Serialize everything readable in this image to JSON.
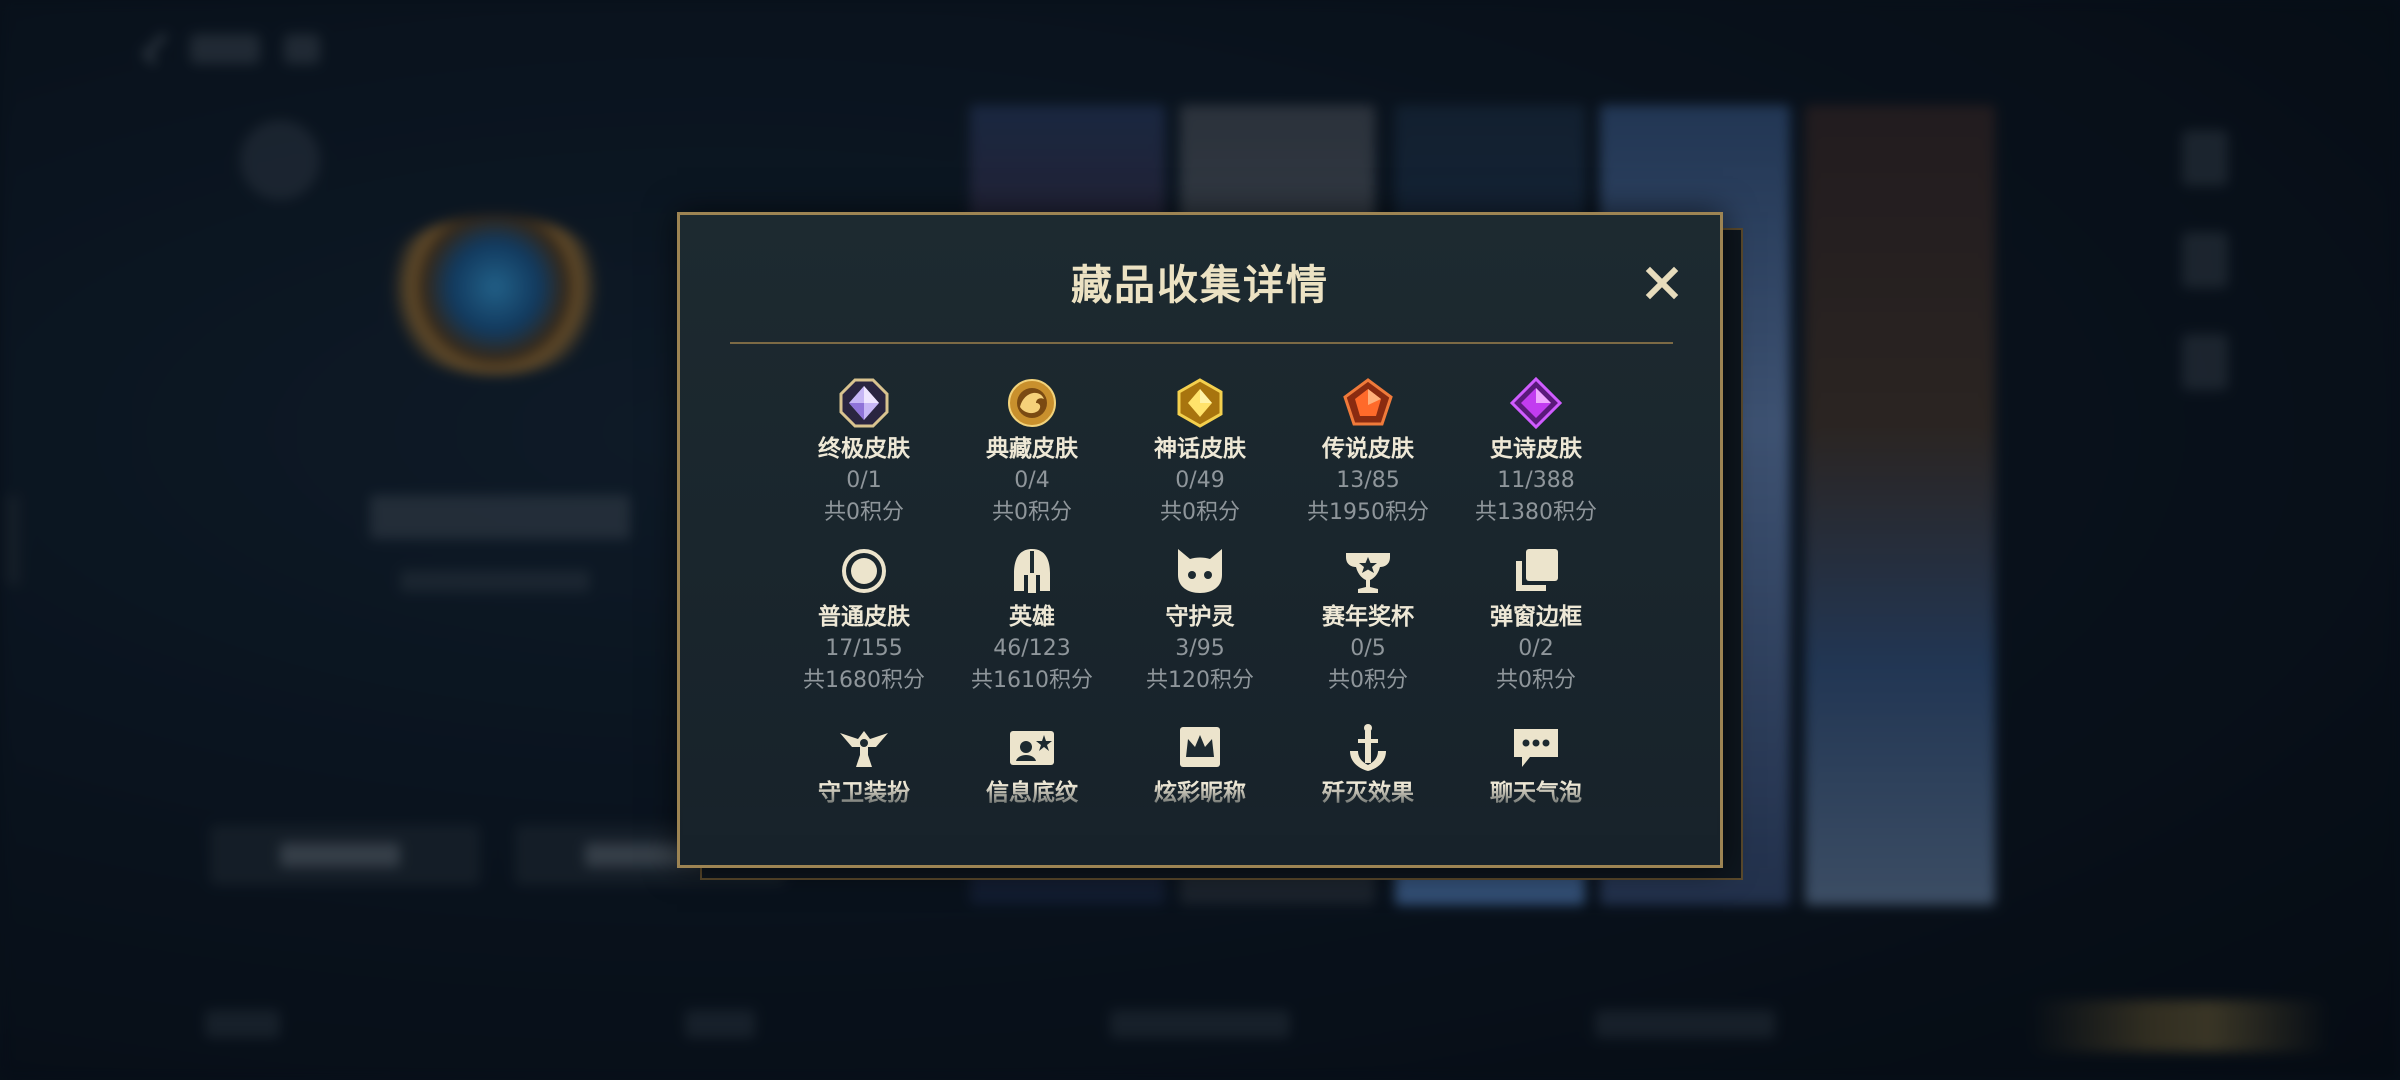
{
  "modal": {
    "title": "藏品收集详情",
    "close_icon": "close-icon",
    "categories": [
      {
        "label": "终极皮肤",
        "count": "0/1",
        "points": "共0积分",
        "icon": "octagon-gem-icon"
      },
      {
        "label": "典藏皮肤",
        "count": "0/4",
        "points": "共0积分",
        "icon": "dragon-medallion-icon"
      },
      {
        "label": "神话皮肤",
        "count": "0/49",
        "points": "共0积分",
        "icon": "gold-hexagon-gem-icon"
      },
      {
        "label": "传说皮肤",
        "count": "13/85",
        "points": "共1950积分",
        "icon": "orange-pentagon-gem-icon"
      },
      {
        "label": "史诗皮肤",
        "count": "11/388",
        "points": "共1380积分",
        "icon": "purple-diamond-gem-icon"
      },
      {
        "label": "普通皮肤",
        "count": "17/155",
        "points": "共1680积分",
        "icon": "ring-icon"
      },
      {
        "label": "英雄",
        "count": "46/123",
        "points": "共1610积分",
        "icon": "helmet-icon"
      },
      {
        "label": "守护灵",
        "count": "3/95",
        "points": "共120积分",
        "icon": "cat-head-icon"
      },
      {
        "label": "赛年奖杯",
        "count": "0/5",
        "points": "共0积分",
        "icon": "trophy-icon"
      },
      {
        "label": "弹窗边框",
        "count": "0/2",
        "points": "共0积分",
        "icon": "stacked-frames-icon"
      },
      {
        "label": "守卫装扮",
        "icon": "ward-icon"
      },
      {
        "label": "信息底纹",
        "icon": "id-card-icon"
      },
      {
        "label": "炫彩昵称",
        "icon": "crown-card-icon"
      },
      {
        "label": "歼灭效果",
        "icon": "sword-icon"
      },
      {
        "label": "聊天气泡",
        "icon": "chat-bubble-icon"
      }
    ]
  },
  "colors": {
    "accent_gold": "#9d8453",
    "title_text": "#ece2c3",
    "muted_text": "#8f969b"
  }
}
